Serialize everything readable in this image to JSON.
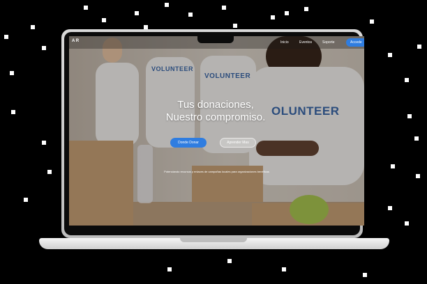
{
  "brand": {
    "logo_text": "A R"
  },
  "nav": {
    "links": [
      "Inicio",
      "Eventos",
      "Soporte"
    ],
    "cta_label": "Accede"
  },
  "hero": {
    "title_line1": "Tus donaciones,",
    "title_line2": "Nuestro compromiso.",
    "primary_button": "Donde Donar",
    "secondary_button": "Aprender Mas",
    "subtitle": "Potenciando recursos y enlaces de campañas locales para organizaciones benéficas",
    "shirt_text_1": "VOLUNTEER",
    "shirt_text_2": "VOLUNTEER",
    "shirt_text_3": "OLUNTEER"
  },
  "colors": {
    "accent": "#2f7de0",
    "shirt_print": "#2d5fa6"
  }
}
